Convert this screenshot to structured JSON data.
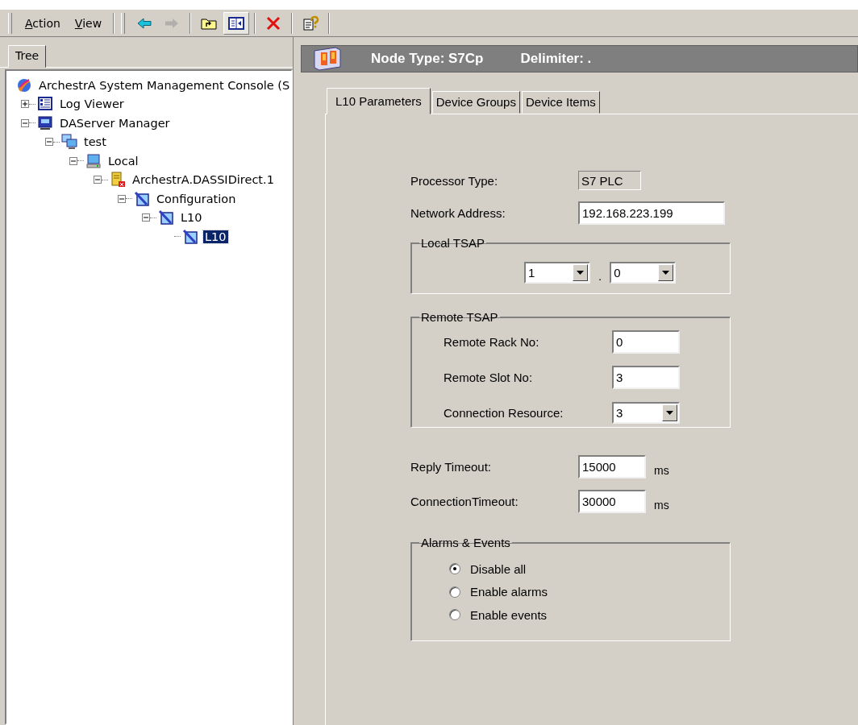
{
  "menu": [
    {
      "label": "Action"
    },
    {
      "label": "View"
    }
  ],
  "toolbar": [
    {
      "kind": "back",
      "disabled": false
    },
    {
      "kind": "forward",
      "disabled": true
    },
    {
      "kind": "sep"
    },
    {
      "kind": "up"
    },
    {
      "kind": "pane",
      "selected": true
    },
    {
      "kind": "sep"
    },
    {
      "kind": "delete"
    },
    {
      "kind": "sep"
    },
    {
      "kind": "help"
    }
  ],
  "tree_tab": {
    "label": "Tree"
  },
  "tree": [
    {
      "label": "ArchestrA System Management Console (S",
      "kind": "console",
      "selected": false,
      "children": [
        {
          "label": "Log Viewer",
          "kind": "log",
          "expanded": false,
          "selected": false
        },
        {
          "label": "DAServer Manager",
          "kind": "manager",
          "expanded": true,
          "selected": false,
          "children": [
            {
              "label": "test",
              "kind": "computers",
              "expanded": true,
              "selected": false,
              "children": [
                {
                  "label": "Local",
                  "kind": "computer",
                  "expanded": true,
                  "selected": false,
                  "children": [
                    {
                      "label": "ArchestrA.DASSIDirect.1",
                      "kind": "server",
                      "expanded": true,
                      "selected": false,
                      "children": [
                        {
                          "label": "Configuration",
                          "kind": "config",
                          "expanded": true,
                          "selected": false,
                          "children": [
                            {
                              "label": "L10",
                              "kind": "config",
                              "expanded": true,
                              "selected": false,
                              "children": [
                                {
                                  "label": "L10",
                                  "kind": "config",
                                  "selected": true
                                }
                              ]
                            }
                          ]
                        }
                      ]
                    }
                  ]
                }
              ]
            }
          ]
        }
      ]
    }
  ],
  "header": {
    "node_type": "Node Type: S7Cp",
    "delimiter": "Delimiter:  ."
  },
  "tabs": [
    {
      "label": "L10 Parameters",
      "selected": true
    },
    {
      "label": "Device Groups",
      "selected": false
    },
    {
      "label": "Device Items",
      "selected": false
    }
  ],
  "processor_type": {
    "label": "Processor Type:",
    "value": "S7 PLC"
  },
  "network_address": {
    "label": "Network Address:",
    "value": "192.168.223.199"
  },
  "local_tsap": {
    "title": "Local TSAP",
    "first": {
      "value": "1"
    },
    "separator": ".",
    "second": {
      "value": "0"
    }
  },
  "remote_tsap": {
    "title": "Remote TSAP",
    "rack": {
      "label": "Remote Rack No:",
      "value": "0"
    },
    "slot": {
      "label": "Remote Slot No:",
      "value": "3"
    },
    "resource": {
      "label": "Connection Resource:",
      "value": "3"
    }
  },
  "reply_timeout": {
    "label": "Reply Timeout:",
    "value": "15000",
    "unit": "ms"
  },
  "connection_timeout": {
    "label": "ConnectionTimeout:",
    "value": "30000",
    "unit": "ms"
  },
  "alarms": {
    "title": "Alarms & Events",
    "options": [
      {
        "label": "Disable all",
        "selected": true
      },
      {
        "label": "Enable alarms",
        "selected": false
      },
      {
        "label": "Enable events",
        "selected": false
      }
    ]
  }
}
